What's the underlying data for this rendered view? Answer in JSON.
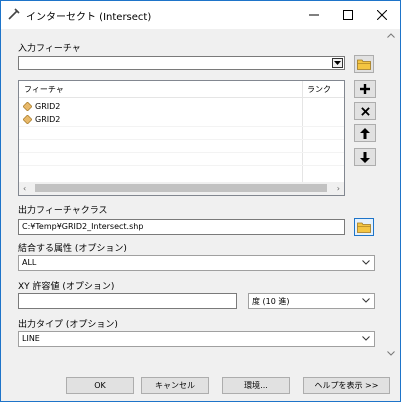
{
  "window": {
    "title": "インターセクト (Intersect)",
    "icons": {
      "app": "intersect-tool-icon",
      "minimize": "minimize-icon",
      "maximize": "maximize-icon",
      "close": "close-icon"
    }
  },
  "input_features": {
    "label": "入力フィーチャ",
    "value": "",
    "columns": [
      "フィーチャ",
      "ランク"
    ],
    "items": [
      {
        "name": "GRID2",
        "rank": ""
      },
      {
        "name": "GRID2",
        "rank": ""
      }
    ],
    "side_buttons": [
      "add-icon",
      "remove-icon",
      "move-up-icon",
      "move-down-icon"
    ]
  },
  "output": {
    "label": "出力フィーチャクラス",
    "value": "C:¥Temp¥GRID2_Intersect.shp"
  },
  "join_attributes": {
    "label": "結合する属性 (オプション)",
    "value": "ALL"
  },
  "xy_tolerance": {
    "label": "XY 許容値 (オプション)",
    "value": "",
    "unit": "度 (10 進)"
  },
  "output_type": {
    "label": "出力タイプ (オプション)",
    "value": "LINE"
  },
  "buttons": {
    "ok": "OK",
    "cancel": "キャンセル",
    "environments": "環境...",
    "show_help": "ヘルプを表示 >>"
  },
  "colors": {
    "accent_border": "#1e74c9",
    "diamond": "#e8b96a",
    "folder": "#f4c542"
  }
}
